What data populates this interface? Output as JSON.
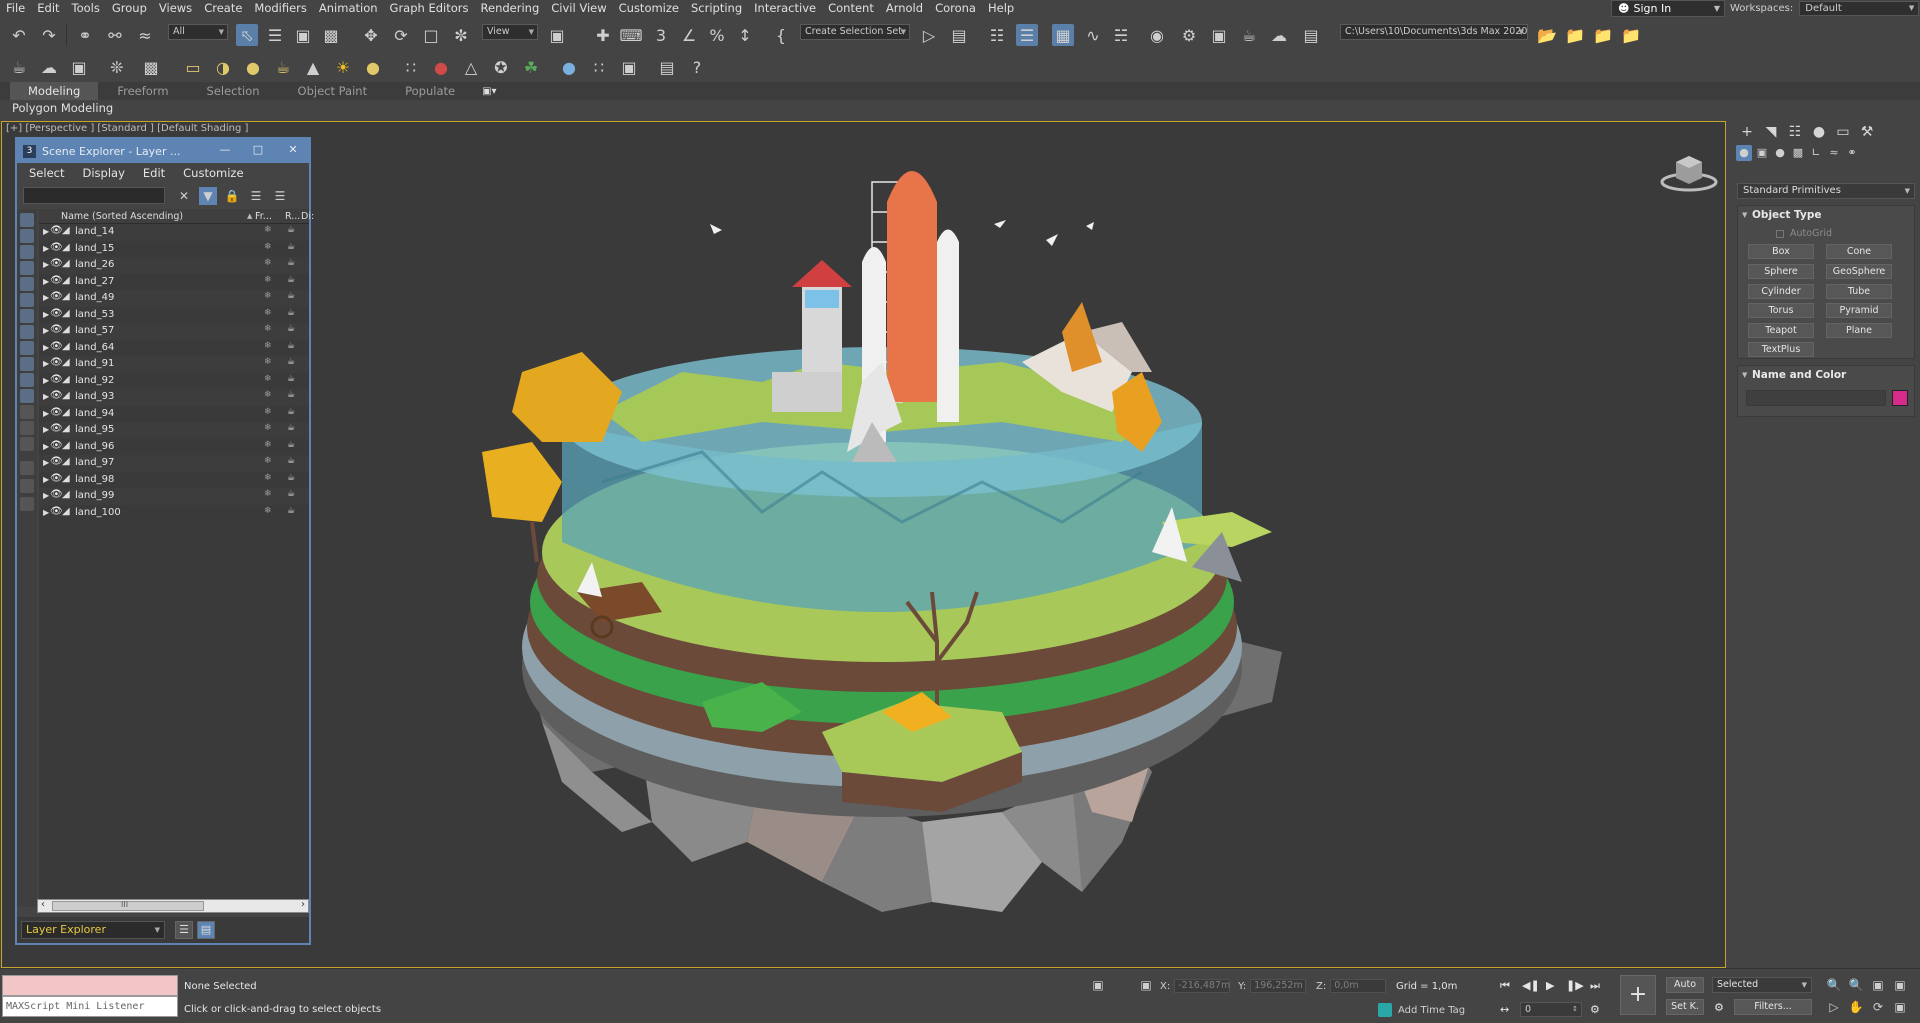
{
  "menubar": {
    "items": [
      "File",
      "Edit",
      "Tools",
      "Group",
      "Views",
      "Create",
      "Modifiers",
      "Animation",
      "Graph Editors",
      "Rendering",
      "Civil View",
      "Customize",
      "Scripting",
      "Interactive",
      "Content",
      "Arnold",
      "Corona",
      "Help"
    ],
    "sign_in": "Sign In",
    "workspaces_label": "Workspaces:",
    "workspaces_value": "Default"
  },
  "toolbar": {
    "filter_value": "All",
    "refcoord_value": "View",
    "selection_set": "Create Selection Set",
    "project_path": "C:\\Users\\10\\Documents\\3ds Max 2020"
  },
  "ribbon": {
    "tabs": [
      "Modeling",
      "Freeform",
      "Selection",
      "Object Paint",
      "Populate"
    ],
    "sub_label": "Polygon Modeling"
  },
  "viewport": {
    "label": "[+] [Perspective ] [Standard ] [Default Shading ]"
  },
  "scene_explorer": {
    "title": "Scene Explorer - Layer ...",
    "menu": [
      "Select",
      "Display",
      "Edit",
      "Customize"
    ],
    "columns": {
      "name": "Name (Sorted Ascending)",
      "frozen": "Fr...",
      "render": "R...",
      "display": "Di:"
    },
    "rows": [
      "land_14",
      "land_15",
      "land_26",
      "land_27",
      "land_49",
      "land_53",
      "land_57",
      "land_64",
      "land_91",
      "land_92",
      "land_93",
      "land_94",
      "land_95",
      "land_96",
      "land_97",
      "land_98",
      "land_99",
      "land_100"
    ],
    "footer_dropdown": "Layer Explorer",
    "scroll_thumb_label": "III"
  },
  "command_panel": {
    "category_dropdown": "Standard Primitives",
    "object_type_title": "Object Type",
    "autogrid_label": "AutoGrid",
    "primitives": [
      "Box",
      "Cone",
      "Sphere",
      "GeoSphere",
      "Cylinder",
      "Tube",
      "Torus",
      "Pyramid",
      "Teapot",
      "Plane",
      "TextPlus"
    ],
    "name_color_title": "Name and Color",
    "object_color": "#d62b8a"
  },
  "statusbar": {
    "maxscript_label": "MAXScript Mini Listener",
    "selection_status": "None Selected",
    "prompt": "Click or click-and-drag to select objects",
    "x_label": "X:",
    "x_value": "-216,487m",
    "y_label": "Y:",
    "y_value": "196,252m",
    "z_label": "Z:",
    "z_value": "0,0m",
    "grid": "Grid = 1,0m",
    "add_time_tag": "Add Time Tag",
    "auto_key": "Auto",
    "set_key": "Set K.",
    "key_filter_dropdown": "Selected",
    "filters_button": "Filters...",
    "current_frame": "0"
  }
}
